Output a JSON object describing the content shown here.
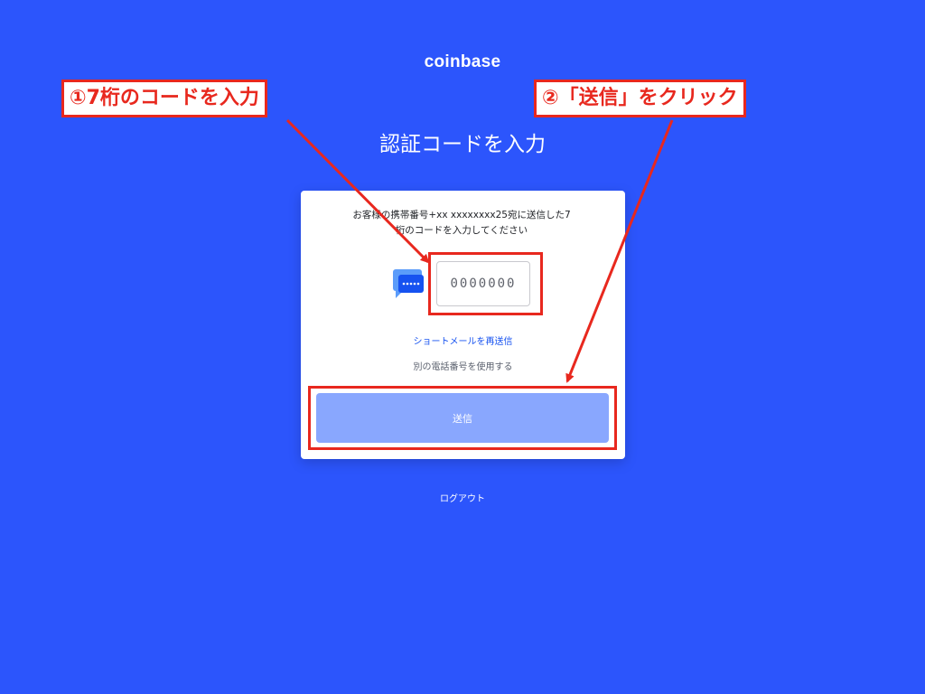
{
  "brand": {
    "logo_text": "coinbase"
  },
  "page": {
    "title": "認証コードを入力"
  },
  "card": {
    "instructions_line1": "お客様の携帯番号+xx xxxxxxxx25宛に送信した7",
    "instructions_line2": "桁のコードを入力してください",
    "code_input": {
      "placeholder": "0000000",
      "value": ""
    },
    "resend_link": "ショートメールを再送信",
    "other_phone_link": "別の電話番号を使用する",
    "submit_button": "送信"
  },
  "footer": {
    "logout_link": "ログアウト"
  },
  "annotations": {
    "step1": "①7桁のコードを入力",
    "step2": "②「送信」をクリック"
  },
  "colors": {
    "background": "#2c55fc",
    "annotation_red": "#e8281e",
    "link_blue": "#1652f0",
    "button_disabled": "#89a7fe"
  },
  "icons": {
    "sms": "sms-message-icon"
  }
}
